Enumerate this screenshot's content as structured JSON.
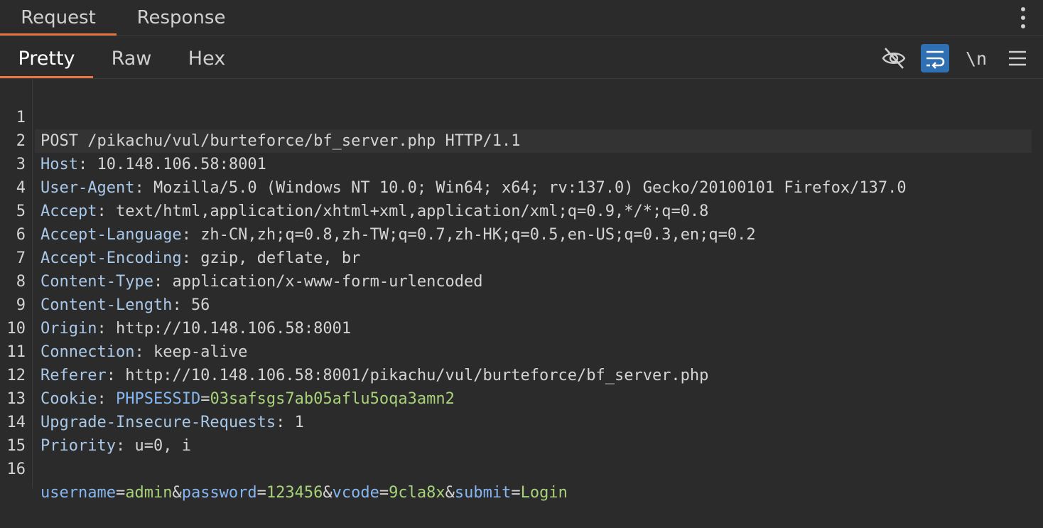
{
  "tabs": [
    "Request",
    "Response"
  ],
  "subtabs": [
    "Pretty",
    "Raw",
    "Hex"
  ],
  "toolbar": {
    "newline_label": "\\n"
  },
  "colors": {
    "accent": "#e8743b",
    "wrap_active": "#2f6fb3",
    "header_name": "#a9c8e8",
    "param_key": "#85b6f0",
    "param_value": "#a8d27a"
  },
  "icons": [
    "hide-icon",
    "word-wrap-icon",
    "newline-icon",
    "menu-icon",
    "more-vertical-icon"
  ],
  "request": {
    "request_line": "POST /pikachu/vul/burteforce/bf_server.php HTTP/1.1",
    "headers": [
      {
        "name": "Host",
        "value": "10.148.106.58:8001"
      },
      {
        "name": "User-Agent",
        "value": "Mozilla/5.0 (Windows NT 10.0; Win64; x64; rv:137.0) Gecko/20100101 Firefox/137.0"
      },
      {
        "name": "Accept",
        "value": "text/html,application/xhtml+xml,application/xml;q=0.9,*/*;q=0.8"
      },
      {
        "name": "Accept-Language",
        "value": "zh-CN,zh;q=0.8,zh-TW;q=0.7,zh-HK;q=0.5,en-US;q=0.3,en;q=0.2"
      },
      {
        "name": "Accept-Encoding",
        "value": "gzip, deflate, br"
      },
      {
        "name": "Content-Type",
        "value": "application/x-www-form-urlencoded"
      },
      {
        "name": "Content-Length",
        "value": "56"
      },
      {
        "name": "Origin",
        "value": "http://10.148.106.58:8001"
      },
      {
        "name": "Connection",
        "value": "keep-alive"
      },
      {
        "name": "Referer",
        "value": "http://10.148.106.58:8001/pikachu/vul/burteforce/bf_server.php"
      },
      {
        "name": "Cookie",
        "cookie_key": "PHPSESSID",
        "cookie_value": "03safsgs7ab05aflu5oqa3amn2"
      },
      {
        "name": "Upgrade-Insecure-Requests",
        "value": "1"
      },
      {
        "name": "Priority",
        "value": "u=0, i"
      }
    ],
    "body_params": [
      {
        "key": "username",
        "value": "admin"
      },
      {
        "key": "password",
        "value": "123456"
      },
      {
        "key": "vcode",
        "value": "9cla8x"
      },
      {
        "key": "submit",
        "value": "Login"
      }
    ],
    "line_numbers": [
      "1",
      "2",
      "3",
      "4",
      "5",
      "6",
      "7",
      "8",
      "9",
      "10",
      "11",
      "12",
      "13",
      "14",
      "15",
      "16"
    ]
  }
}
